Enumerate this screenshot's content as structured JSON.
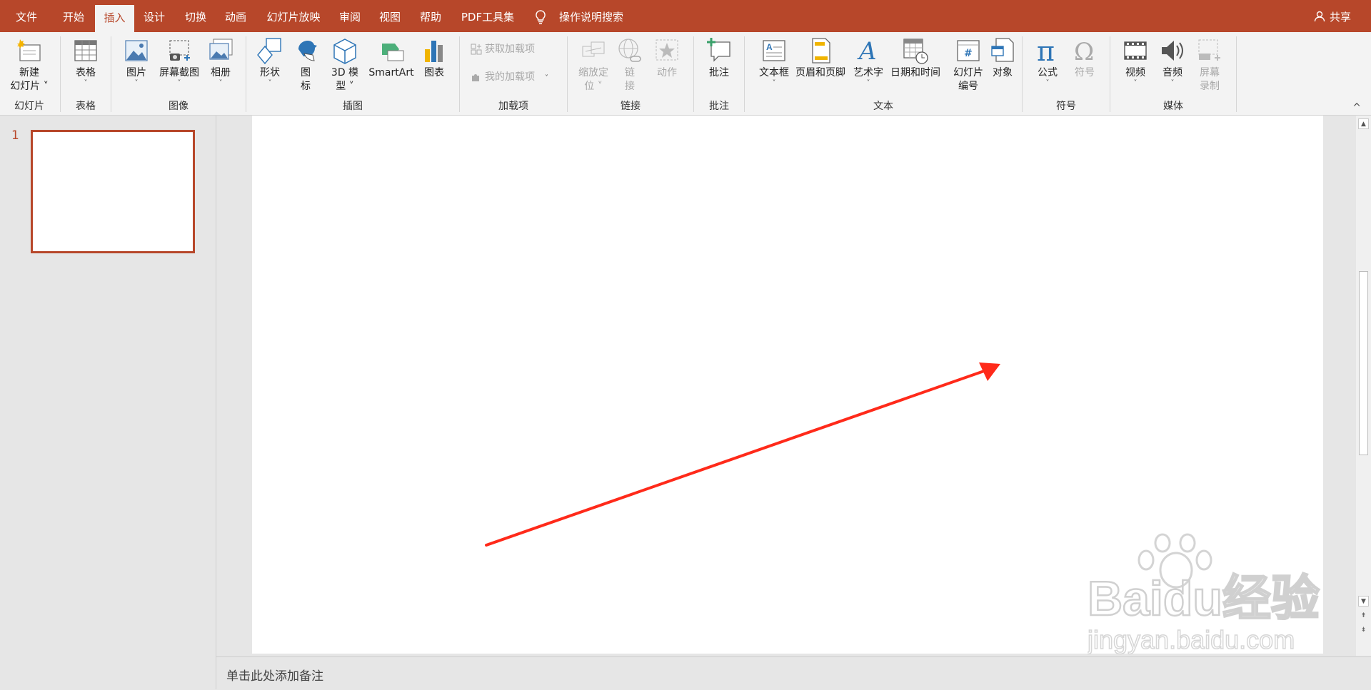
{
  "menubar": {
    "tabs": [
      {
        "label": "文件"
      },
      {
        "label": "开始"
      },
      {
        "label": "插入"
      },
      {
        "label": "设计"
      },
      {
        "label": "切换"
      },
      {
        "label": "动画"
      },
      {
        "label": "幻灯片放映"
      },
      {
        "label": "审阅"
      },
      {
        "label": "视图"
      },
      {
        "label": "帮助"
      },
      {
        "label": "PDF工具集"
      }
    ],
    "active_tab": "插入",
    "tell_me": "操作说明搜索",
    "share": "共享"
  },
  "ribbon": {
    "groups": {
      "slides": {
        "label": "幻灯片",
        "new_slide_line1": "新建",
        "new_slide_line2": "幻灯片"
      },
      "tables": {
        "label": "表格",
        "table": "表格"
      },
      "images": {
        "label": "图像",
        "picture": "图片",
        "screenshot": "屏幕截图",
        "album": "相册"
      },
      "illustrations": {
        "label": "插图",
        "shapes": "形状",
        "icons_line1": "图",
        "icons_line2": "标",
        "model3d_line1": "3D 模",
        "model3d_line2": "型",
        "smartart": "SmartArt",
        "chart": "图表"
      },
      "addins": {
        "label": "加载项",
        "get_addins": "获取加载项",
        "my_addins": "我的加载项"
      },
      "links": {
        "label": "链接",
        "zoom_line1": "缩放定",
        "zoom_line2": "位",
        "link_line1": "链",
        "link_line2": "接",
        "action": "动作"
      },
      "comments": {
        "label": "批注",
        "comment": "批注"
      },
      "text": {
        "label": "文本",
        "textbox": "文本框",
        "header_footer": "页眉和页脚",
        "wordart": "艺术字",
        "datetime": "日期和时间",
        "slide_number_line1": "幻灯片",
        "slide_number_line2": "编号",
        "object": "对象"
      },
      "symbols": {
        "label": "符号",
        "equation": "公式",
        "symbol": "符号"
      },
      "media": {
        "label": "媒体",
        "video": "视频",
        "audio": "音频",
        "screen_rec_line1": "屏幕",
        "screen_rec_line2": "录制"
      }
    }
  },
  "thumbnails": {
    "slide_number": "1"
  },
  "notes": {
    "placeholder": "单击此处添加备注"
  },
  "colors": {
    "accent": "#b7472a",
    "arrow": "#ff2a1a"
  },
  "watermark": {
    "text": "Baidu经验",
    "url": "jingyan.baidu.com"
  }
}
